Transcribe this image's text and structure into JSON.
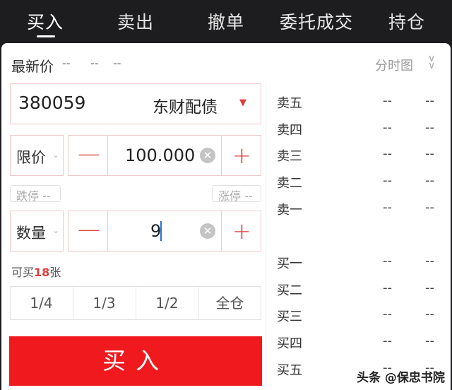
{
  "tabs": [
    "买入",
    "卖出",
    "撤单",
    "委托成交",
    "持仓"
  ],
  "quote": {
    "label": "最新价",
    "v1": "--",
    "v2": "--",
    "v3": "--",
    "chart_link": "分时图"
  },
  "stock": {
    "code": "380059",
    "name": "东财配债"
  },
  "price": {
    "type": "限价",
    "value": "100.000",
    "limit_down": "跌停 --",
    "limit_up": "涨停 --"
  },
  "qty": {
    "type": "数量",
    "value": "9"
  },
  "available": {
    "prefix": "可买",
    "num": "18",
    "suffix": "张"
  },
  "fractions": [
    "1/4",
    "1/3",
    "1/2",
    "全仓"
  ],
  "buy_label": "买入",
  "order_book": {
    "asks": [
      {
        "label": "卖五",
        "price": "--",
        "vol": "--"
      },
      {
        "label": "卖四",
        "price": "--",
        "vol": "--"
      },
      {
        "label": "卖三",
        "price": "--",
        "vol": "--"
      },
      {
        "label": "卖二",
        "price": "--",
        "vol": "--"
      },
      {
        "label": "卖一",
        "price": "--",
        "vol": "--"
      }
    ],
    "bids": [
      {
        "label": "买一",
        "price": "--",
        "vol": "--"
      },
      {
        "label": "买二",
        "price": "--",
        "vol": "--"
      },
      {
        "label": "买三",
        "price": "--",
        "vol": "--"
      },
      {
        "label": "买四",
        "price": "--",
        "vol": "--"
      },
      {
        "label": "买五",
        "price": "--",
        "vol": "--"
      }
    ]
  },
  "watermark": "头条 @保忠书院",
  "colors": {
    "accent": "#f0191e",
    "dark": "#1d1d1f"
  }
}
